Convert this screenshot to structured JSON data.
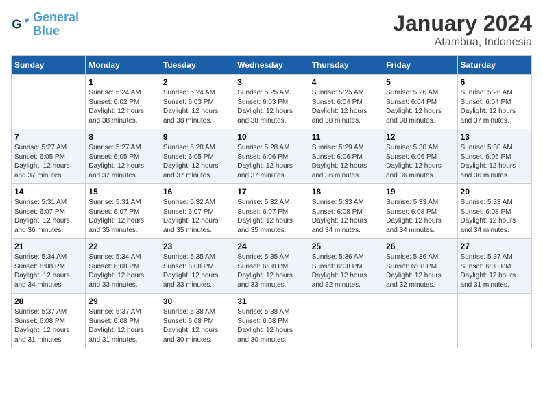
{
  "header": {
    "logo_line1": "General",
    "logo_line2": "Blue",
    "month_title": "January 2024",
    "subtitle": "Atambua, Indonesia"
  },
  "weekdays": [
    "Sunday",
    "Monday",
    "Tuesday",
    "Wednesday",
    "Thursday",
    "Friday",
    "Saturday"
  ],
  "weeks": [
    [
      {
        "day": "",
        "info": ""
      },
      {
        "day": "1",
        "info": "Sunrise: 5:24 AM\nSunset: 6:02 PM\nDaylight: 12 hours\nand 38 minutes."
      },
      {
        "day": "2",
        "info": "Sunrise: 5:24 AM\nSunset: 6:03 PM\nDaylight: 12 hours\nand 38 minutes."
      },
      {
        "day": "3",
        "info": "Sunrise: 5:25 AM\nSunset: 6:03 PM\nDaylight: 12 hours\nand 38 minutes."
      },
      {
        "day": "4",
        "info": "Sunrise: 5:25 AM\nSunset: 6:04 PM\nDaylight: 12 hours\nand 38 minutes."
      },
      {
        "day": "5",
        "info": "Sunrise: 5:26 AM\nSunset: 6:04 PM\nDaylight: 12 hours\nand 38 minutes."
      },
      {
        "day": "6",
        "info": "Sunrise: 5:26 AM\nSunset: 6:04 PM\nDaylight: 12 hours\nand 37 minutes."
      }
    ],
    [
      {
        "day": "7",
        "info": "Sunrise: 5:27 AM\nSunset: 6:05 PM\nDaylight: 12 hours\nand 37 minutes."
      },
      {
        "day": "8",
        "info": "Sunrise: 5:27 AM\nSunset: 6:05 PM\nDaylight: 12 hours\nand 37 minutes."
      },
      {
        "day": "9",
        "info": "Sunrise: 5:28 AM\nSunset: 6:05 PM\nDaylight: 12 hours\nand 37 minutes."
      },
      {
        "day": "10",
        "info": "Sunrise: 5:28 AM\nSunset: 6:06 PM\nDaylight: 12 hours\nand 37 minutes."
      },
      {
        "day": "11",
        "info": "Sunrise: 5:29 AM\nSunset: 6:06 PM\nDaylight: 12 hours\nand 36 minutes."
      },
      {
        "day": "12",
        "info": "Sunrise: 5:30 AM\nSunset: 6:06 PM\nDaylight: 12 hours\nand 36 minutes."
      },
      {
        "day": "13",
        "info": "Sunrise: 5:30 AM\nSunset: 6:06 PM\nDaylight: 12 hours\nand 36 minutes."
      }
    ],
    [
      {
        "day": "14",
        "info": "Sunrise: 5:31 AM\nSunset: 6:07 PM\nDaylight: 12 hours\nand 36 minutes."
      },
      {
        "day": "15",
        "info": "Sunrise: 5:31 AM\nSunset: 6:07 PM\nDaylight: 12 hours\nand 35 minutes."
      },
      {
        "day": "16",
        "info": "Sunrise: 5:32 AM\nSunset: 6:07 PM\nDaylight: 12 hours\nand 35 minutes."
      },
      {
        "day": "17",
        "info": "Sunrise: 5:32 AM\nSunset: 6:07 PM\nDaylight: 12 hours\nand 35 minutes."
      },
      {
        "day": "18",
        "info": "Sunrise: 5:33 AM\nSunset: 6:08 PM\nDaylight: 12 hours\nand 34 minutes."
      },
      {
        "day": "19",
        "info": "Sunrise: 5:33 AM\nSunset: 6:08 PM\nDaylight: 12 hours\nand 34 minutes."
      },
      {
        "day": "20",
        "info": "Sunrise: 5:33 AM\nSunset: 6:08 PM\nDaylight: 12 hours\nand 34 minutes."
      }
    ],
    [
      {
        "day": "21",
        "info": "Sunrise: 5:34 AM\nSunset: 6:08 PM\nDaylight: 12 hours\nand 34 minutes."
      },
      {
        "day": "22",
        "info": "Sunrise: 5:34 AM\nSunset: 6:08 PM\nDaylight: 12 hours\nand 33 minutes."
      },
      {
        "day": "23",
        "info": "Sunrise: 5:35 AM\nSunset: 6:08 PM\nDaylight: 12 hours\nand 33 minutes."
      },
      {
        "day": "24",
        "info": "Sunrise: 5:35 AM\nSunset: 6:08 PM\nDaylight: 12 hours\nand 33 minutes."
      },
      {
        "day": "25",
        "info": "Sunrise: 5:36 AM\nSunset: 6:08 PM\nDaylight: 12 hours\nand 32 minutes."
      },
      {
        "day": "26",
        "info": "Sunrise: 5:36 AM\nSunset: 6:08 PM\nDaylight: 12 hours\nand 32 minutes."
      },
      {
        "day": "27",
        "info": "Sunrise: 5:37 AM\nSunset: 6:08 PM\nDaylight: 12 hours\nand 31 minutes."
      }
    ],
    [
      {
        "day": "28",
        "info": "Sunrise: 5:37 AM\nSunset: 6:08 PM\nDaylight: 12 hours\nand 31 minutes."
      },
      {
        "day": "29",
        "info": "Sunrise: 5:37 AM\nSunset: 6:08 PM\nDaylight: 12 hours\nand 31 minutes."
      },
      {
        "day": "30",
        "info": "Sunrise: 5:38 AM\nSunset: 6:08 PM\nDaylight: 12 hours\nand 30 minutes."
      },
      {
        "day": "31",
        "info": "Sunrise: 5:38 AM\nSunset: 6:08 PM\nDaylight: 12 hours\nand 30 minutes."
      },
      {
        "day": "",
        "info": ""
      },
      {
        "day": "",
        "info": ""
      },
      {
        "day": "",
        "info": ""
      }
    ]
  ]
}
